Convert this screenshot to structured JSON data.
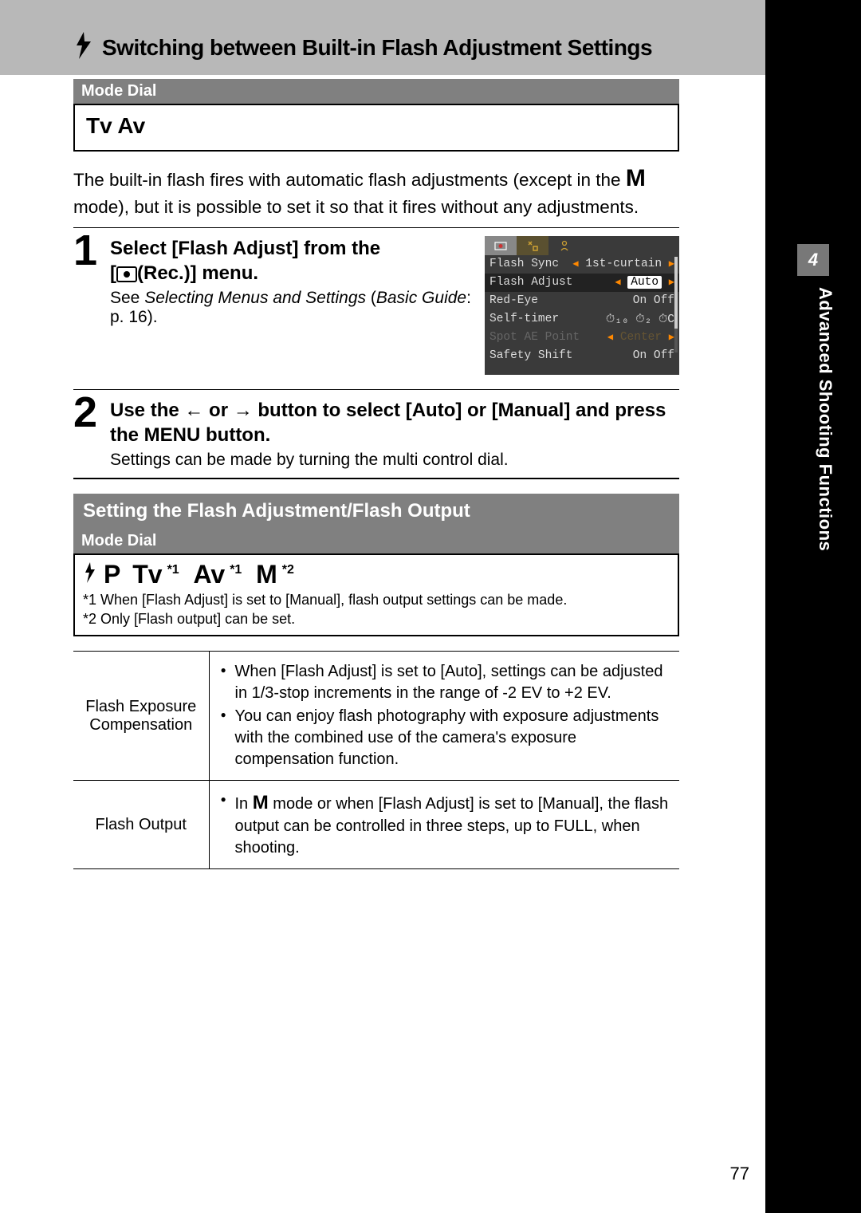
{
  "sidebar": {
    "section_number": "4",
    "label": "Advanced Shooting Functions"
  },
  "title": "Switching between Built-in Flash Adjustment Settings",
  "mode_dial_label": "Mode Dial",
  "mode_box_text": "Tv Av",
  "intro_pre": "The built-in flash fires with automatic flash adjustments (except in the ",
  "intro_m": "M",
  "intro_post": " mode), but it is possible to set it so that it fires without any adjustments.",
  "step1": {
    "num": "1",
    "heading_a": "Select [Flash Adjust] from the",
    "heading_b": "(Rec.)] menu.",
    "bracket_open": "[",
    "text_a": "See ",
    "text_em": "Selecting Menus and Settings",
    "text_b": " (",
    "text_em2": "Basic Guide",
    "text_c": ": p. 16)."
  },
  "screenshot": {
    "rows": [
      {
        "label": "Flash Sync",
        "value": "1st-curtain",
        "tri": true
      },
      {
        "label": "Flash Adjust",
        "value": "Auto",
        "selected": true,
        "tri": true
      },
      {
        "label": "Red-Eye",
        "value": "On Off"
      },
      {
        "label": "Self-timer",
        "value": "⏱₁₀ ⏱₂ ⏱C",
        "gold": true
      },
      {
        "label": "Spot AE Point",
        "value": "Center",
        "dimmed": true,
        "tri": true
      },
      {
        "label": "Safety Shift",
        "value": "On Off"
      }
    ]
  },
  "step2": {
    "num": "2",
    "heading_a": "Use the ",
    "heading_b": " or ",
    "heading_c": " button to select [Auto] or [Manual] and press the MENU button.",
    "text": "Settings can be made by turning the multi control dial."
  },
  "section2": {
    "title": "Setting the Flash Adjustment/Flash Output",
    "modes_label": "Mode Dial",
    "modes": {
      "p": "P",
      "tv": "Tv",
      "sup1": "*1",
      "av": "Av",
      "sup1b": "*1",
      "m": "M",
      "sup2": "*2"
    },
    "footnote1": "*1 When [Flash Adjust] is set to [Manual], flash output settings can be made.",
    "footnote2": "*2 Only [Flash output] can be set."
  },
  "table": {
    "row1_head": "Flash Exposure Compensation",
    "row1_b1": "When [Flash Adjust] is set to [Auto], settings can be adjusted in 1/3-stop increments in the range of -2 EV to +2 EV.",
    "row1_b2": "You can enjoy flash photography with exposure adjustments with the combined use of the camera's exposure compensation function.",
    "row2_head": "Flash Output",
    "row2_b1_a": "In ",
    "row2_b1_m": "M",
    "row2_b1_b": " mode or when [Flash Adjust] is set to [Manual], the flash output can be controlled in three steps, up to FULL, when shooting."
  },
  "page_num": "77"
}
